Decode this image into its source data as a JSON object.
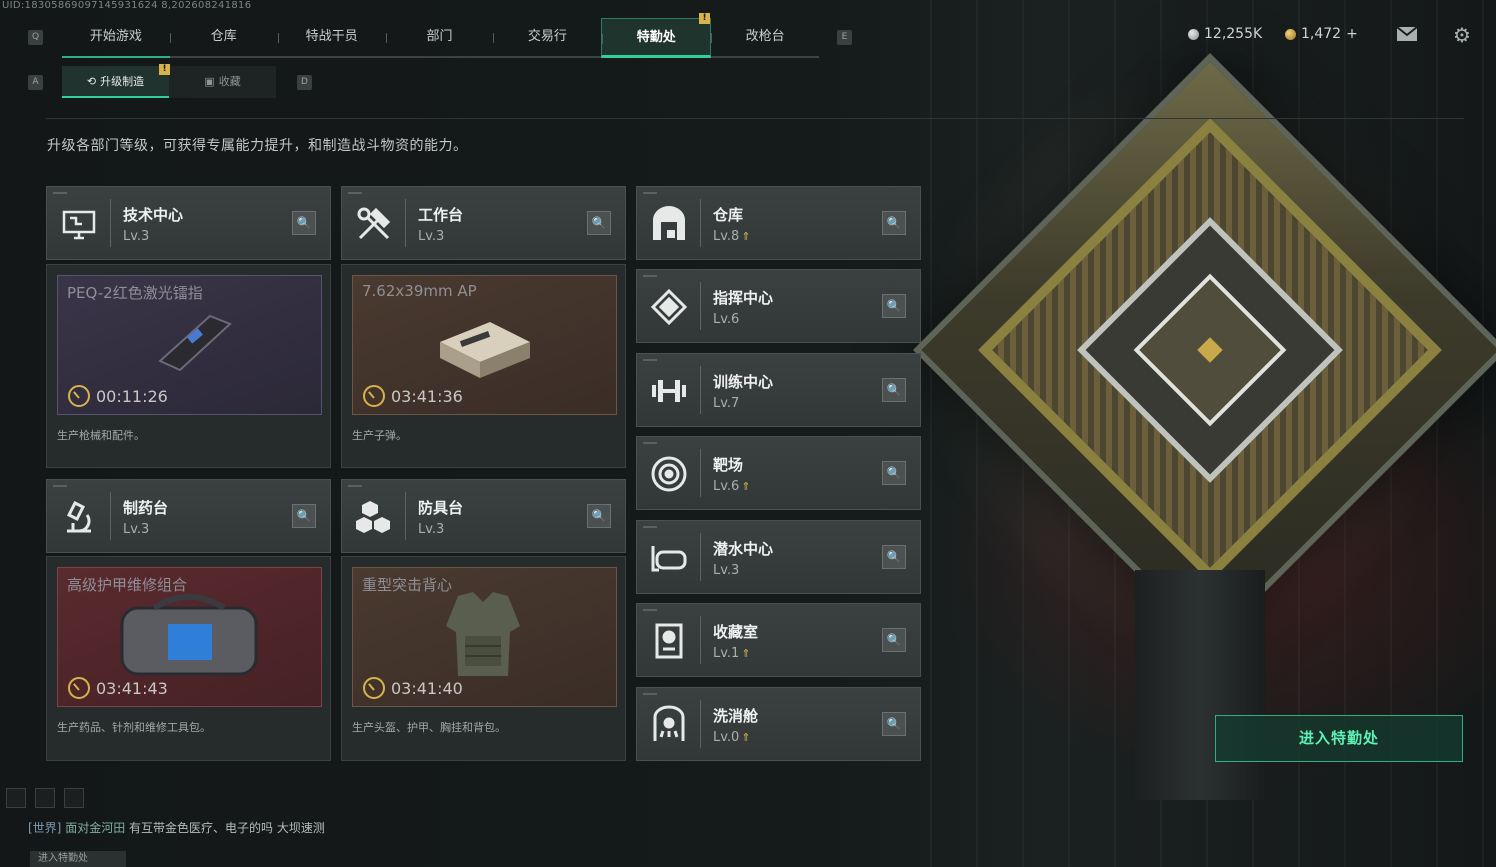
{
  "uid": "UID:18305869097145931624 8,202608241816",
  "key_hints": {
    "q": "Q",
    "e": "E",
    "a": "A",
    "d": "D"
  },
  "topnav": {
    "tabs": [
      "开始游戏",
      "仓库",
      "特战干员",
      "部门",
      "交易行",
      "特勤处",
      "改枪台"
    ],
    "badge": "!"
  },
  "currency": {
    "silver": "12,255K",
    "gold": "1,472",
    "gold_add": "+"
  },
  "subnav": {
    "tabs": [
      "升级制造",
      "收藏"
    ],
    "badge": "!"
  },
  "description": "升级各部门等级，可获得专属能力提升，和制造战斗物资的能力。",
  "departments": [
    {
      "name": "技术中心",
      "level": "Lv.3",
      "icon": "computer-icon",
      "item": "PEQ-2红色激光镭指",
      "timer": "00:11:26",
      "desc": "生产枪械和配件。"
    },
    {
      "name": "工作台",
      "level": "Lv.3",
      "icon": "tools-icon",
      "item": "7.62x39mm AP",
      "timer": "03:41:36",
      "desc": "生产子弹。"
    },
    {
      "name": "制药台",
      "level": "Lv.3",
      "icon": "microscope-icon",
      "item": "高级护甲维修组合",
      "timer": "03:41:43",
      "desc": "生产药品、针剂和维修工具包。"
    },
    {
      "name": "防具台",
      "level": "Lv.3",
      "icon": "boxes-icon",
      "item": "重型突击背心",
      "timer": "03:41:40",
      "desc": "生产头盔、护甲、胸挂和背包。"
    }
  ],
  "side_departments": [
    {
      "name": "仓库",
      "level": "Lv.8",
      "upgrade": true,
      "icon": "warehouse-icon"
    },
    {
      "name": "指挥中心",
      "level": "Lv.6",
      "upgrade": false,
      "icon": "chip-icon"
    },
    {
      "name": "训练中心",
      "level": "Lv.7",
      "upgrade": false,
      "icon": "dumbbell-icon"
    },
    {
      "name": "靶场",
      "level": "Lv.6",
      "upgrade": true,
      "icon": "target-icon"
    },
    {
      "name": "潜水中心",
      "level": "Lv.3",
      "upgrade": false,
      "icon": "goggles-icon"
    },
    {
      "name": "收藏室",
      "level": "Lv.1",
      "upgrade": true,
      "icon": "display-case-icon"
    },
    {
      "name": "洗消舱",
      "level": "Lv.0",
      "upgrade": true,
      "icon": "shower-icon"
    }
  ],
  "enter_button": "进入特勤处",
  "chat": {
    "channel": "[世界]",
    "user": "面对金河田",
    "message": "有互带金色医疗、电子的吗  大坝速测"
  },
  "bottom_button": "进入特勤处",
  "colors": {
    "accent": "#2fd09a",
    "badge": "#d9b34a",
    "upgrade": "#d7b44f"
  }
}
